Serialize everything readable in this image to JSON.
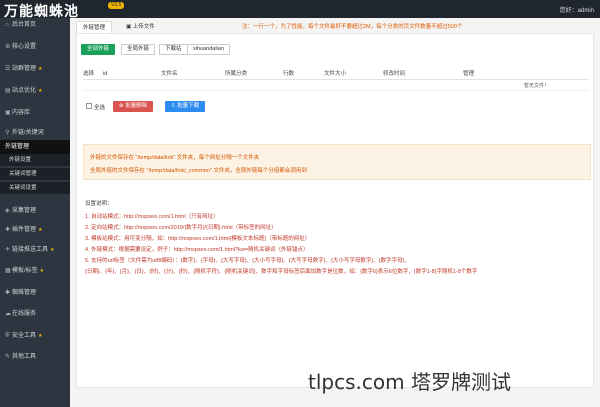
{
  "app": {
    "logo": "万能蜘蛛池",
    "version": "V2.5",
    "user": "您好：admin"
  },
  "sidebar": {
    "items": [
      {
        "icon": "home-icon",
        "label": "后台首页"
      },
      {
        "icon": "gear-icon",
        "label": "核心设置"
      },
      {
        "icon": "list-icon",
        "label": "站群管理",
        "pin": "★"
      },
      {
        "icon": "chart-icon",
        "label": "站点优化",
        "pin": "★"
      },
      {
        "icon": "doc-icon",
        "label": "内容库"
      },
      {
        "icon": "link-icon",
        "label": "外链/关键词"
      },
      {
        "icon": "link-icon",
        "label": "外链管理"
      }
    ],
    "subitems": [
      "外链设置",
      "关键词管理",
      "关键词设置"
    ],
    "items2": [
      {
        "icon": "collect-icon",
        "label": "采集管理"
      },
      {
        "icon": "plugin-icon",
        "label": "插件管理",
        "pin": "★"
      },
      {
        "icon": "push-icon",
        "label": "链接推送工具",
        "pin": "★"
      },
      {
        "icon": "template-icon",
        "label": "模板/标签",
        "pin": "★"
      },
      {
        "icon": "spider-icon",
        "label": "蜘蛛管理"
      },
      {
        "icon": "service-icon",
        "label": "在线服务"
      },
      {
        "icon": "shield-icon",
        "label": "安全工具",
        "pin": "★"
      },
      {
        "icon": "tool-icon",
        "label": "其他工具"
      }
    ]
  },
  "tabs": [
    {
      "label": "外链管理"
    },
    {
      "label": "上传文件"
    }
  ],
  "notice": "注：一行一个，为了性能，每个文件最好不要超过2M，每个分类的页文件数量不超过500个",
  "toolbar": {
    "all": "全部外链",
    "global": "全局外链",
    "default": "下载站",
    "custom": "xihuandalian"
  },
  "table": {
    "headers": [
      "选择",
      "id",
      "文件名",
      "所属分类",
      "行数",
      "文件大小",
      "修改时间",
      "管理"
    ],
    "empty": "暂无文件！"
  },
  "bulk": {
    "select_all": "全选",
    "delete": "批量删除",
    "download": "批量下载"
  },
  "info": {
    "line1": "外链的文件保存在 \"/temp/data/link\" 文件夹，每个网址分隔一个文件夹",
    "line2": "全局外链的文件保存在 \"/temp/data/link/_common\" 文件夹，全局外链每个分组都会调用到"
  },
  "help": {
    "title": "设置说明：",
    "lines": [
      "1. 自动站模式：http://mspseo.com/1.html（只有网址）",
      "2. 定向站模式：http://mspseo.com/2019/{数字月}/{日期}.html（带标签的网址）",
      "3. 模板站模式：用可变分隔，如：http://mspseo.com/1.html{模板文本标题}（带标题的网址）",
      "4. 外链模式：根据需要设定，例子：http://mspseo.com/1.html?kw=随机关键词（外链锚点）",
      "5. 支持的url标签（文件需为utf8编码）：{数字}、{字母}、{大写字母}、{大小写字母}、{大写字母数字}、{大小写字母数字}、{数字字母}、",
      "{日期}、{年}、{月}、{日}、{时}、{分}、{秒}、{随机字符}、{随机关键词}、数字和字母标签后面加数字是位数，如：{数字6}表示6位数字，{数字1-8}字随机1-8个数字"
    ]
  },
  "watermark": "tlpcs.com 塔罗牌测试"
}
